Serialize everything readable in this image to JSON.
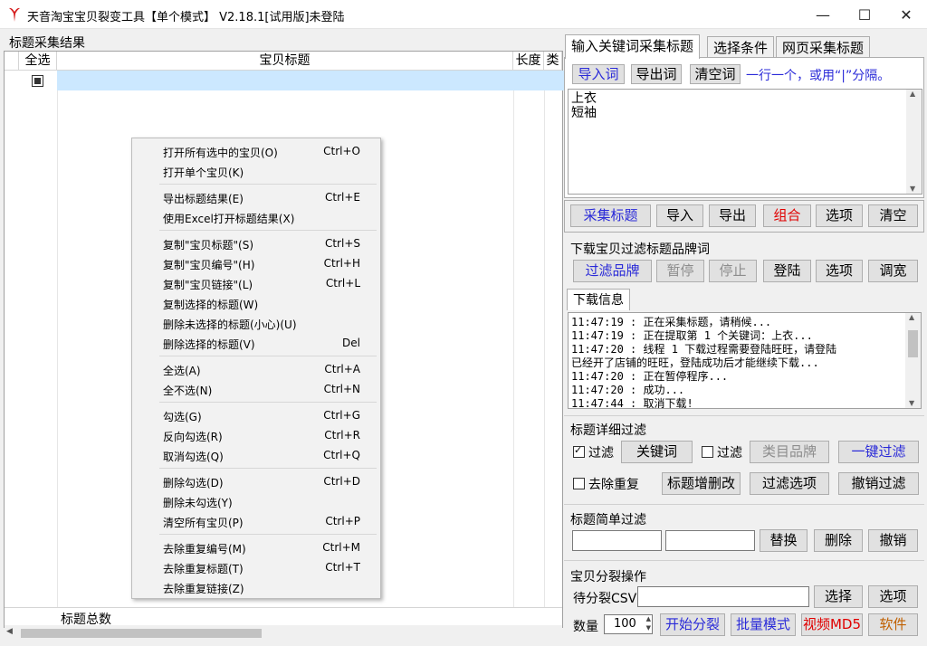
{
  "window": {
    "title": "天音淘宝宝贝裂变工具【单个模式】 V2.18.1[试用版]未登陆",
    "minimize": "—",
    "maximize": "☐",
    "close": "✕"
  },
  "left": {
    "section_label": "标题采集结果",
    "columns": [
      "全选",
      "宝贝标题",
      "长度",
      "类"
    ],
    "footer_label": "标题总数"
  },
  "context_menu": {
    "items": [
      {
        "label": "打开所有选中的宝贝(O)",
        "shortcut": "Ctrl+O"
      },
      {
        "label": "打开单个宝贝(K)",
        "shortcut": ""
      },
      {
        "label": "导出标题结果(E)",
        "shortcut": "Ctrl+E"
      },
      {
        "label": "使用Excel打开标题结果(X)",
        "shortcut": ""
      },
      {
        "label": "复制\"宝贝标题\"(S)",
        "shortcut": "Ctrl+S"
      },
      {
        "label": "复制\"宝贝编号\"(H)",
        "shortcut": "Ctrl+H"
      },
      {
        "label": "复制\"宝贝链接\"(L)",
        "shortcut": "Ctrl+L"
      },
      {
        "label": "复制选择的标题(W)",
        "shortcut": ""
      },
      {
        "label": "删除未选择的标题(小心)(U)",
        "shortcut": ""
      },
      {
        "label": "删除选择的标题(V)",
        "shortcut": "Del"
      },
      {
        "label": "全选(A)",
        "shortcut": "Ctrl+A"
      },
      {
        "label": "全不选(N)",
        "shortcut": "Ctrl+N"
      },
      {
        "label": "勾选(G)",
        "shortcut": "Ctrl+G"
      },
      {
        "label": "反向勾选(R)",
        "shortcut": "Ctrl+R"
      },
      {
        "label": "取消勾选(Q)",
        "shortcut": "Ctrl+Q"
      },
      {
        "label": "删除勾选(D)",
        "shortcut": "Ctrl+D"
      },
      {
        "label": "删除未勾选(Y)",
        "shortcut": ""
      },
      {
        "label": "清空所有宝贝(P)",
        "shortcut": "Ctrl+P"
      },
      {
        "label": "去除重复编号(M)",
        "shortcut": "Ctrl+M"
      },
      {
        "label": "去除重复标题(T)",
        "shortcut": "Ctrl+T"
      },
      {
        "label": "去除重复链接(Z)",
        "shortcut": ""
      }
    ]
  },
  "tabs": [
    "输入关键词采集标题",
    "选择条件",
    "网页采集标题"
  ],
  "keyword_panel": {
    "import": "导入词",
    "export": "导出词",
    "clear": "清空词",
    "hint": "一行一个，或用“|”分隔。",
    "keywords": "上衣\n短袖"
  },
  "collect_bar": {
    "collect": "采集标题",
    "import": "导入",
    "export": "导出",
    "combine": "组合",
    "options": "选项",
    "clear": "清空"
  },
  "brand_filter": {
    "title": "下载宝贝过滤标题品牌词",
    "filter_brand": "过滤品牌",
    "pause": "暂停",
    "stop": "停止",
    "login": "登陆",
    "options": "选项",
    "adjust_width": "调宽"
  },
  "download_info": {
    "tab": "下载信息",
    "log": "11:47:19 : 正在采集标题，请稍候...\n11:47:19 : 正在提取第 1 个关键词：上衣...\n11:47:20 : 线程 1 下载过程需要登陆旺旺，请登陆\n已经开了店铺的旺旺，登陆成功后才能继续下载...\n11:47:20 : 正在暂停程序...\n11:47:20 : 成功...\n11:47:44 : 取消下载!"
  },
  "detail_filter": {
    "title": "标题详细过滤",
    "filter1_label": "过滤",
    "filter1_checked": true,
    "keyword_btn": "关键词",
    "filter2_label": "过滤",
    "filter2_checked": false,
    "category_brand_btn": "类目品牌",
    "one_click_btn": "一键过滤",
    "dedupe_label": "去除重复",
    "dedupe_checked": false,
    "title_edit_btn": "标题增删改",
    "filter_options_btn": "过滤选项",
    "undo_filter_btn": "撤销过滤"
  },
  "simple_filter": {
    "title": "标题简单过滤",
    "replace": "替换",
    "delete": "删除",
    "undo": "撤销"
  },
  "split": {
    "title": "宝贝分裂操作",
    "csv_label": "待分裂CSV",
    "select": "选择",
    "options": "选项",
    "qty_label": "数量",
    "qty_value": "100",
    "start": "开始分裂",
    "batch": "批量模式",
    "video_md5": "视频MD5",
    "software": "软件"
  },
  "colors": {
    "accent_blue": "#2a2ad8",
    "red": "#e00000",
    "selection": "#cce8ff"
  }
}
